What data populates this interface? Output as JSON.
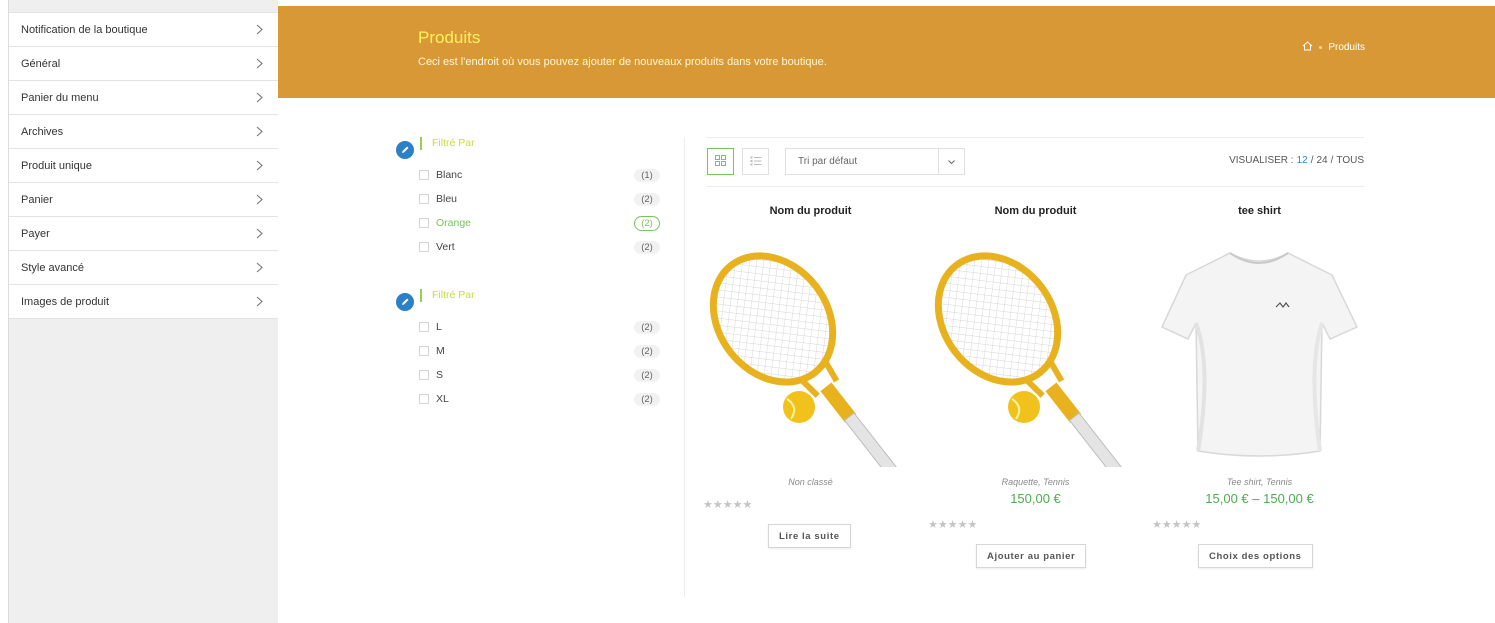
{
  "sidebar": {
    "items": [
      {
        "label": "Notification de la boutique"
      },
      {
        "label": "Général"
      },
      {
        "label": "Panier du menu"
      },
      {
        "label": "Archives"
      },
      {
        "label": "Produit unique"
      },
      {
        "label": "Panier"
      },
      {
        "label": "Payer"
      },
      {
        "label": "Style avancé"
      },
      {
        "label": "Images de produit"
      }
    ]
  },
  "header": {
    "title": "Produits",
    "subtitle": "Ceci est l'endroit où vous pouvez ajouter de nouveaux produits dans votre boutique.",
    "breadcrumb": "Produits"
  },
  "filters": [
    {
      "title": "Filtré Par",
      "options": [
        {
          "label": "Blanc",
          "count": "(1)",
          "active": false
        },
        {
          "label": "Bleu",
          "count": "(2)",
          "active": false
        },
        {
          "label": "Orange",
          "count": "(2)",
          "active": true
        },
        {
          "label": "Vert",
          "count": "(2)",
          "active": false
        }
      ]
    },
    {
      "title": "Filtré Par",
      "options": [
        {
          "label": "L",
          "count": "(2)",
          "active": false
        },
        {
          "label": "M",
          "count": "(2)",
          "active": false
        },
        {
          "label": "S",
          "count": "(2)",
          "active": false
        },
        {
          "label": "XL",
          "count": "(2)",
          "active": false
        }
      ]
    }
  ],
  "toolbar": {
    "sort_value": "Tri par défaut",
    "view_label": "VISUALISER :",
    "per_page_12": "12",
    "per_page_sep1": "/",
    "per_page_24": "24",
    "per_page_sep2": "/",
    "per_page_all": "TOUS"
  },
  "products": [
    {
      "name": "Nom du produit",
      "category": "Non classé",
      "price": "",
      "stars": "★★★★★",
      "button": "Lire la suite",
      "image": "tennis-racket"
    },
    {
      "name": "Nom du produit",
      "category": "Raquette, Tennis",
      "price": "150,00 €",
      "stars": "★★★★★",
      "button": "Ajouter au panier",
      "image": "tennis-racket"
    },
    {
      "name": "tee shirt",
      "category": "Tee shirt, Tennis",
      "price": "15,00 € – 150,00 €",
      "stars": "★★★★★",
      "button": "Choix des options",
      "image": "t-shirt"
    }
  ],
  "colors": {
    "header_bg": "#d99836",
    "title": "#fff45a",
    "price": "#4cae4c",
    "accent_green": "#79c35a",
    "pencil_badge": "#2c7fc9"
  }
}
